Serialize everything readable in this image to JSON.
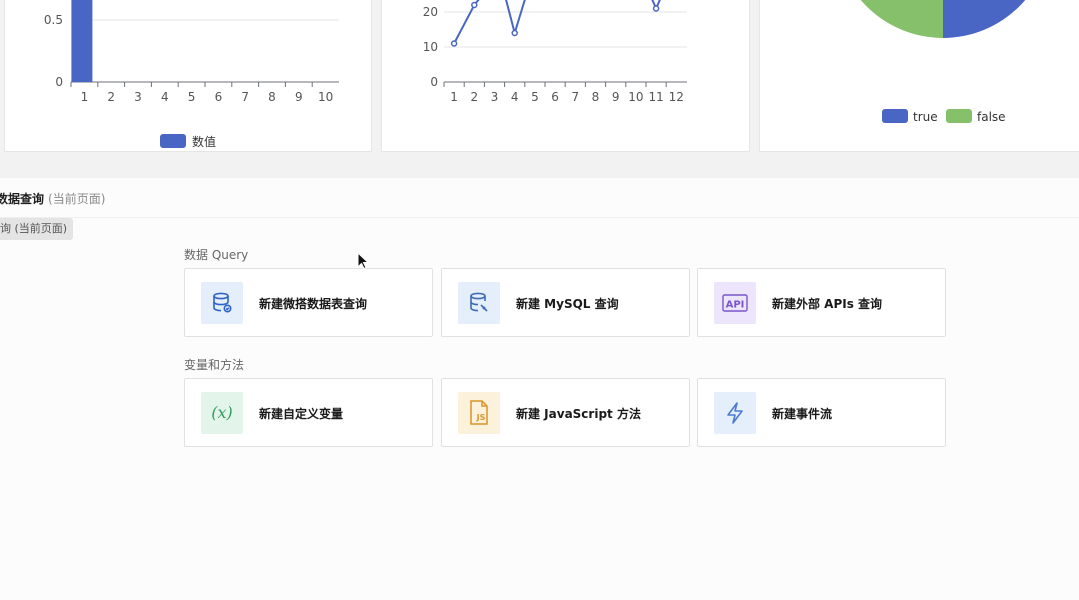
{
  "charts": {
    "bar": {
      "type": "bar",
      "categories": [
        "1",
        "2",
        "3",
        "4",
        "5",
        "6",
        "7",
        "8",
        "9",
        "10"
      ],
      "values": [
        1,
        null,
        null,
        null,
        null,
        null,
        null,
        null,
        null,
        null
      ],
      "y_ticks": [
        "0.5",
        "0"
      ],
      "legend": "数值",
      "color": "#4a66c5"
    },
    "line": {
      "type": "line",
      "x": [
        "1",
        "2",
        "3",
        "4",
        "5",
        "6",
        "7",
        "8",
        "9",
        "10",
        "11",
        "12"
      ],
      "visible_values": [
        11,
        22,
        null,
        14,
        null,
        null,
        null,
        null,
        null,
        null,
        21,
        null
      ],
      "y_ticks": [
        "20",
        "10",
        "0"
      ],
      "color": "#4a66c5"
    },
    "pie": {
      "type": "pie",
      "legend": [
        {
          "name": "true",
          "color": "#4a66c5"
        },
        {
          "name": "false",
          "color": "#86c06a"
        }
      ]
    }
  },
  "query": {
    "title": "数据查询",
    "title_sub": "(当前页面)",
    "tooltip": "询 (当前页面)"
  },
  "sections": [
    {
      "label": "数据 Query",
      "cards": [
        {
          "label": "新建微搭数据表查询",
          "icon": "database-icon",
          "icon_bg": "#e5eefb",
          "icon_color": "#2f64c7"
        },
        {
          "label": "新建 MySQL 查询",
          "icon": "mysql-icon",
          "icon_bg": "#e5eefb",
          "icon_color": "#3d6bb3"
        },
        {
          "label": "新建外部 APIs 查询",
          "icon": "api-icon",
          "icon_bg": "#ece5fb",
          "icon_color": "#7a55c9"
        }
      ]
    },
    {
      "label": "变量和方法",
      "cards": [
        {
          "label": "新建自定义变量",
          "icon": "variable-icon",
          "icon_bg": "#e3f5ea",
          "icon_color": "#2e9c5d"
        },
        {
          "label": "新建 JavaScript 方法",
          "icon": "javascript-icon",
          "icon_bg": "#fcf2dc",
          "icon_color": "#d9952a"
        },
        {
          "label": "新建事件流",
          "icon": "lightning-icon",
          "icon_bg": "#e5eefb",
          "icon_color": "#4a7bd0"
        }
      ]
    }
  ]
}
